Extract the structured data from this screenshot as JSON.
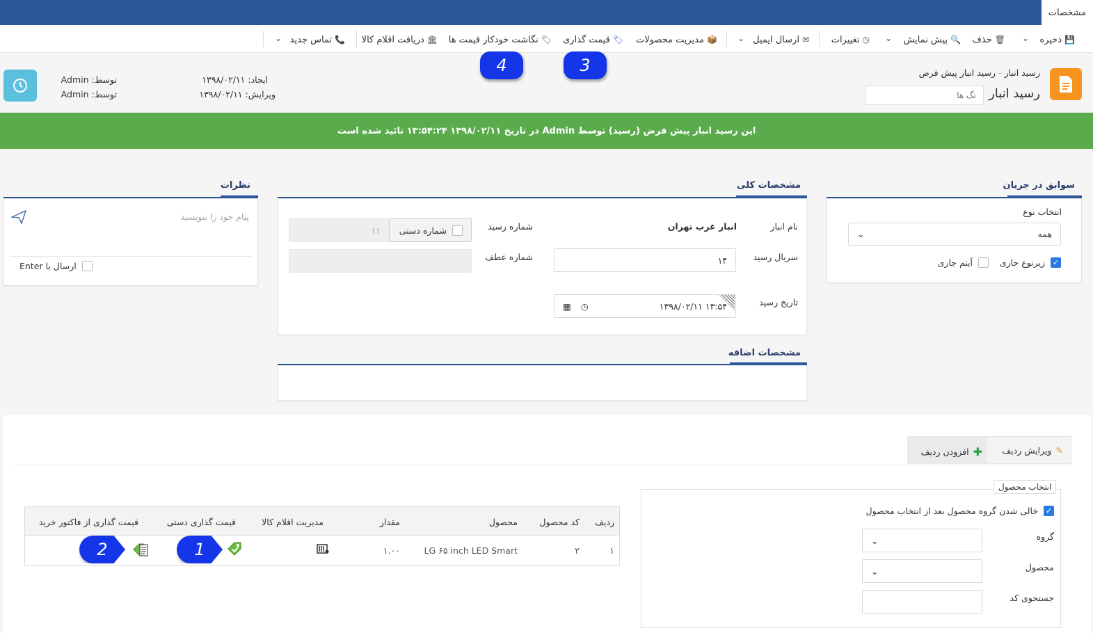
{
  "window": {
    "tab": "مشخصات"
  },
  "toolbar": {
    "save": "ذخیره",
    "delete": "حذف",
    "preview": "پیش نمایش",
    "changes": "تغییرات",
    "send_email": "ارسال ایمیل",
    "product_management": "مدیریت محصولات",
    "pricing": "قیمت گذاری",
    "auto_price_map": "نگاشت خودکار قیمت ها",
    "receive_items": "دریافت اقلام کالا",
    "new_contact": "تماس جدید"
  },
  "callouts": {
    "c1": "1",
    "c2": "2",
    "c3": "3",
    "c4": "4"
  },
  "header": {
    "breadcrumb_parent": "رسید انبار",
    "breadcrumb_sep": "-",
    "breadcrumb_current": "رسید انبار پیش فرض",
    "title": "رسید انبار",
    "tags_placeholder": "تگ ها",
    "created_label": "ایجاد:",
    "created_value": "۱۳۹۸/۰۲/۱۱",
    "edited_label": "ویرایش:",
    "edited_value": "۱۳۹۸/۰۲/۱۱",
    "by_label": "توسط:",
    "created_by": "Admin",
    "edited_by": "Admin"
  },
  "banner": {
    "text": "این رسید انبار پیش فرض (رسید) توسط Admin در تاریخ ۱۳۹۸/۰۲/۱۱ ۱۳:۵۴:۲۴ تائید شده است"
  },
  "workflow": {
    "title": "سوابق در جریان",
    "type_label": "انتخاب نوع",
    "type_value": "همه",
    "current_subtype": "زیرنوع جاری",
    "current_item": "آیتم جاری"
  },
  "general": {
    "title": "مشخصات کلی",
    "warehouse_label": "نام انبار",
    "warehouse_value": "انبار غرب تهران",
    "serial_label": "سریال رسید",
    "serial_value": "۱۴",
    "date_label": "تاریخ رسید",
    "date_value": "۱۳:۵۴ ۱۳۹۸/۰۲/۱۱",
    "receipt_no_label": "شماره رسید",
    "manual_no_label": "شماره دستی",
    "receipt_no_value": "۱۱",
    "ref_no_label": "شماره عطف"
  },
  "extra": {
    "title": "مشخصات اضافه"
  },
  "comments": {
    "title": "نظرات",
    "placeholder": "پیام خود را بنویسید",
    "send_with_enter": "ارسال با Enter"
  },
  "rows_toolbar": {
    "edit_row": "ویرایش ردیف",
    "add_row": "افزودن ردیف"
  },
  "product_select": {
    "legend": "انتخاب محصول",
    "clear_group": "خالی شدن گروه محصول بعد از انتخاب محصول",
    "group_label": "گروه",
    "product_label": "محصول",
    "code_search_label": "جستجوی کد"
  },
  "table": {
    "headers": [
      "ردیف",
      "کد محصول",
      "محصول",
      "مقدار",
      "مدیریت اقلام کالا",
      "قیمت گذاری دستی",
      "قیمت گذاری از فاکتور خرید"
    ],
    "rows": [
      {
        "index": "۱",
        "code": "۲",
        "product": "LG ۶۵ inch LED Smart",
        "qty": "۱.۰۰"
      }
    ]
  },
  "icons": {
    "save": "floppy-icon",
    "delete": "trash-icon",
    "preview": "magnifier-icon",
    "changes": "history-icon",
    "email": "envelope-icon",
    "products": "box-icon",
    "pricing": "tag-icon",
    "auto_price": "tags-icon",
    "receive": "warehouse-icon",
    "contact": "phone-icon"
  },
  "colors": {
    "brand": "#2b579a",
    "success": "#5aab4c",
    "doc": "#f7941d",
    "clock": "#5bc0de",
    "callout": "#1436e8"
  }
}
